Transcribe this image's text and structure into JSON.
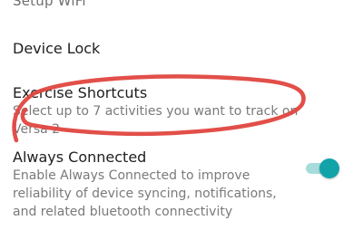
{
  "settings": {
    "partial_top_item": "Setup WiFi",
    "items": [
      {
        "title": "Device Lock"
      },
      {
        "title": "Exercise Shortcuts",
        "description_lines": [
          "Select up to 7 activities you want to track on",
          "Versa 2"
        ]
      },
      {
        "title": "Always Connected",
        "description_lines": [
          "Enable Always Connected to improve",
          "reliability of device syncing, notifications,",
          "and related bluetooth connectivity"
        ],
        "toggle_on": true
      }
    ]
  },
  "colors": {
    "toggle_track": "#a6dcdc",
    "toggle_thumb": "#12a3a9",
    "annotation_stroke": "#e0463f"
  },
  "icons": {
    "annotation": "red-scribble-circle"
  }
}
